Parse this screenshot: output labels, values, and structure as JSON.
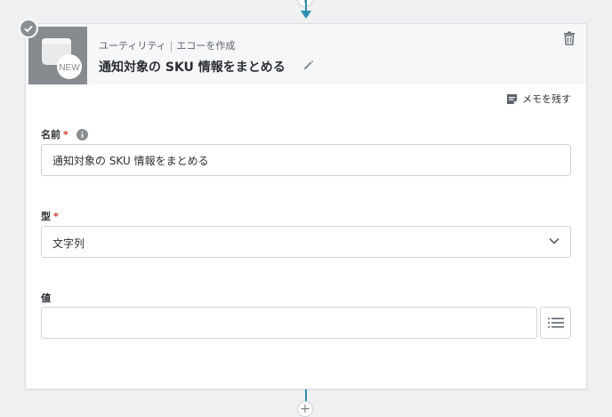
{
  "step": {
    "category": "ユーティリティ",
    "action": "エコーを作成",
    "title": "通知対象の SKU 情報をまとめる",
    "badge": "NEW"
  },
  "memo": {
    "label": "メモを残す"
  },
  "fields": {
    "name": {
      "label": "名前",
      "required_mark": "*",
      "value": "通知対象の SKU 情報をまとめる"
    },
    "type": {
      "label": "型",
      "required_mark": "*",
      "selected": "文字列"
    },
    "value": {
      "label": "値",
      "value": ""
    }
  },
  "connectors": {
    "plus_glyph": "+"
  },
  "icons": {
    "status": "check-circle-icon",
    "step": "window-new-icon",
    "edit": "pencil-icon",
    "delete": "trash-icon",
    "memo": "note-icon",
    "info": "info-icon",
    "select": "chevron-down-icon",
    "list": "list-icon"
  },
  "colors": {
    "connector": "#2d8fb0",
    "required": "#d0302c",
    "step_icon_bg": "#878b8f",
    "header_bg": "#f6f7f8",
    "page_bg": "#eef0f2"
  }
}
